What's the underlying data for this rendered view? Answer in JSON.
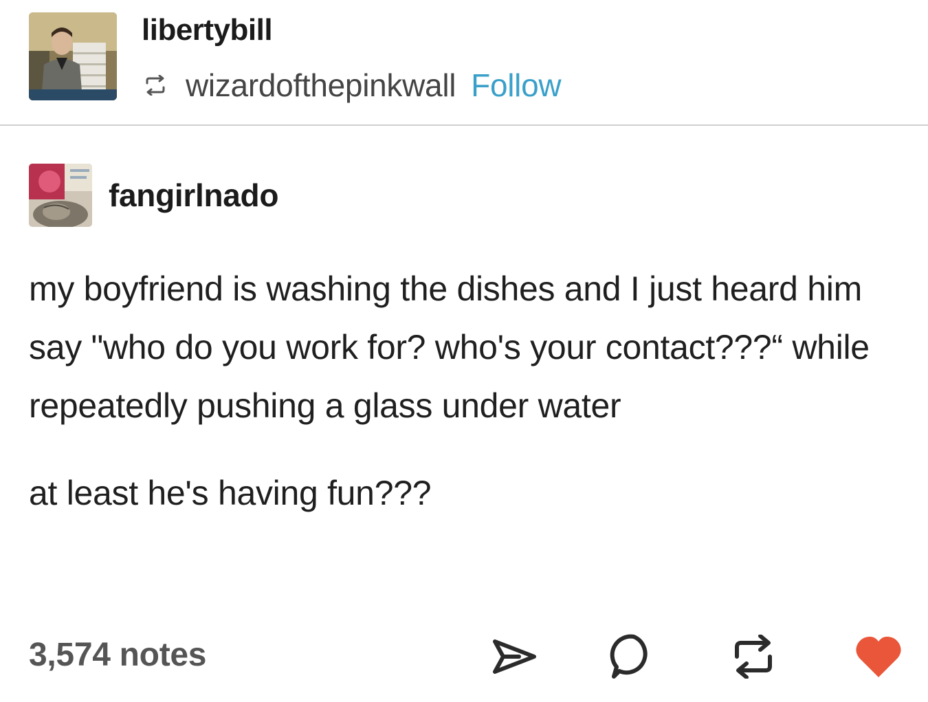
{
  "post": {
    "blog_name": "libertybill",
    "reblogged_from": "wizardofthepinkwall",
    "follow_label": "Follow"
  },
  "original_post": {
    "author": "fangirlnado",
    "paragraphs": [
      "my boyfriend is washing the dishes and I just heard him say \"who do you work for? who's your contact???“ while repeatedly pushing a glass under water",
      "at least he's having fun???"
    ]
  },
  "footer": {
    "notes_label": "3,574 notes"
  },
  "icons": {
    "reblog_small": "reblog-icon",
    "share": "share-icon",
    "reply": "reply-icon",
    "reblog": "reblog-icon",
    "like": "heart-icon"
  },
  "colors": {
    "follow_link": "#3aa0c9",
    "heart": "#e9563a",
    "icon_dark": "#2b2b2b"
  }
}
